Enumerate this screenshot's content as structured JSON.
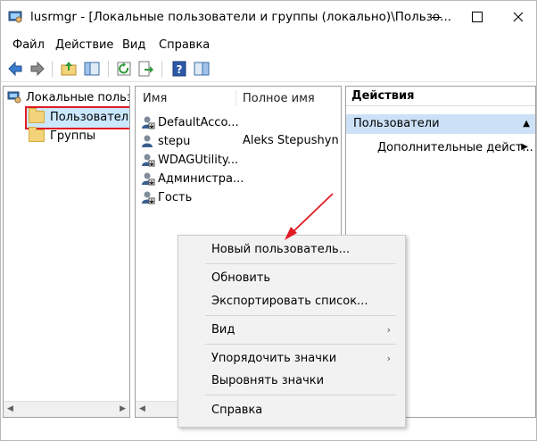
{
  "window": {
    "title": "lusrmgr - [Локальные пользователи и группы (локально)\\Пользо..."
  },
  "menubar": [
    "Файл",
    "Действие",
    "Вид",
    "Справка"
  ],
  "tree": {
    "root": "Локальные пользо",
    "items": [
      "Пользователи",
      "Группы"
    ]
  },
  "list": {
    "columns": [
      "Имя",
      "Полное имя"
    ],
    "rows": [
      {
        "name": "DefaultAcco...",
        "full_name": ""
      },
      {
        "name": "stepu",
        "full_name": "Aleks Stepushyn"
      },
      {
        "name": "WDAGUtility...",
        "full_name": ""
      },
      {
        "name": "Администра...",
        "full_name": ""
      },
      {
        "name": "Гость",
        "full_name": ""
      }
    ]
  },
  "actions": {
    "header": "Действия",
    "section": "Пользователи",
    "item": "Дополнительные дейст..."
  },
  "context_menu": {
    "items": [
      "Новый пользователь...",
      "Обновить",
      "Экспортировать список...",
      "Вид",
      "Упорядочить значки",
      "Выровнять значки",
      "Справка"
    ]
  },
  "colors": {
    "selection": "#cce8ff",
    "highlight_border": "#e01b24",
    "action_section_bg": "#cce1f7",
    "annotation_arrow": "#e01b24"
  }
}
